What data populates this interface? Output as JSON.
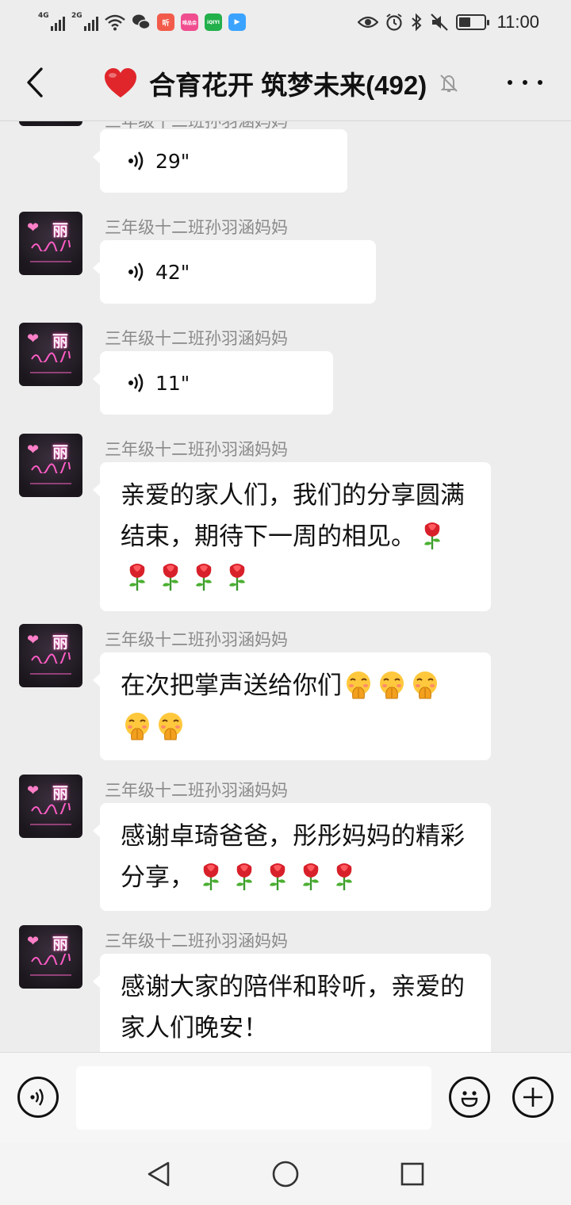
{
  "status_bar": {
    "signal_1": "4G",
    "signal_2": "2G",
    "app_icons": [
      {
        "name": "ting-icon",
        "label": "听",
        "color": "#f25b4a"
      },
      {
        "name": "store-icon",
        "label": "唯品会",
        "color": "#f04d8f"
      },
      {
        "name": "iqiyi-icon",
        "label": "iQIYI",
        "color": "#22b04b"
      },
      {
        "name": "video-icon",
        "label": "▶",
        "color": "#3aa3ff"
      }
    ],
    "time": "11:00",
    "battery_level": 0.45
  },
  "header": {
    "title": "合育花开 筑梦未来(492)",
    "heart_color": "#e0262b"
  },
  "messages": [
    {
      "sender": "三年级十二班孙羽涵妈妈",
      "type": "voice",
      "duration": "29\""
    },
    {
      "sender": "三年级十二班孙羽涵妈妈",
      "type": "voice",
      "duration": "42\""
    },
    {
      "sender": "三年级十二班孙羽涵妈妈",
      "type": "voice",
      "duration": "11\""
    },
    {
      "sender": "三年级十二班孙羽涵妈妈",
      "type": "text",
      "text": "亲爱的家人们，我们的分享圆满结束，期待下一周的相见。",
      "emoji": "rose-emoji",
      "emoji_count": 5
    },
    {
      "sender": "三年级十二班孙羽涵妈妈",
      "type": "text",
      "text": "在次把掌声送给你们",
      "emoji": "shy-clap-emoji",
      "emoji_count": 5
    },
    {
      "sender": "三年级十二班孙羽涵妈妈",
      "type": "text",
      "text": "感谢卓琦爸爸，彤彤妈妈的精彩分享，",
      "emoji": "rose-emoji",
      "emoji_count": 5
    },
    {
      "sender": "三年级十二班孙羽涵妈妈",
      "type": "text",
      "text": "感谢大家的陪伴和聆听，亲爱的家人们晚安！"
    }
  ],
  "avatar": {
    "big_char": "丽"
  },
  "input_bar": {
    "value": "",
    "placeholder": ""
  }
}
